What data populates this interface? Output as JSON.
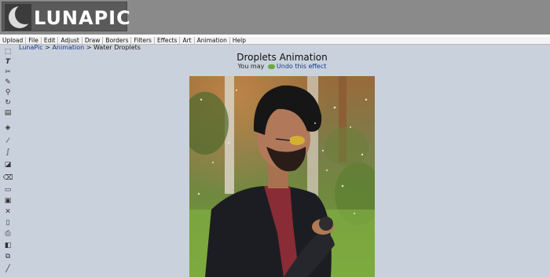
{
  "logo": {
    "text": "LUNAPIC"
  },
  "menu": [
    "Upload",
    "File",
    "Edit",
    "Adjust",
    "Draw",
    "Borders",
    "Filters",
    "Effects",
    "Art",
    "Animation",
    "Help"
  ],
  "toolbar": {
    "tools": [
      "select-tool-icon",
      "text-tool-icon",
      "scissors-icon",
      "pencil-icon",
      "zoom-icon",
      "rotate-icon",
      "layers-icon",
      "paint-bucket-icon",
      "eyedropper-icon",
      "brush-icon",
      "crop-icon",
      "eraser-icon",
      "open-folder-icon",
      "save-icon",
      "close-icon",
      "new-file-icon",
      "print-icon",
      "history-icon",
      "copy-icon",
      "line-icon"
    ]
  },
  "breadcrumb": {
    "home": "LunaPic",
    "sep1": " > ",
    "section": "Animation",
    "sep2": " > ",
    "current": "Water Droplets"
  },
  "page": {
    "title": "Droplets Animation",
    "undo_prefix": "You may ",
    "undo_link": "Undo this effect"
  },
  "colors": {
    "header_bg": "#8a8a8a",
    "page_bg": "#c9d1dc",
    "link": "#1a3a8a",
    "menubar_bg": "#f3f3f3"
  }
}
